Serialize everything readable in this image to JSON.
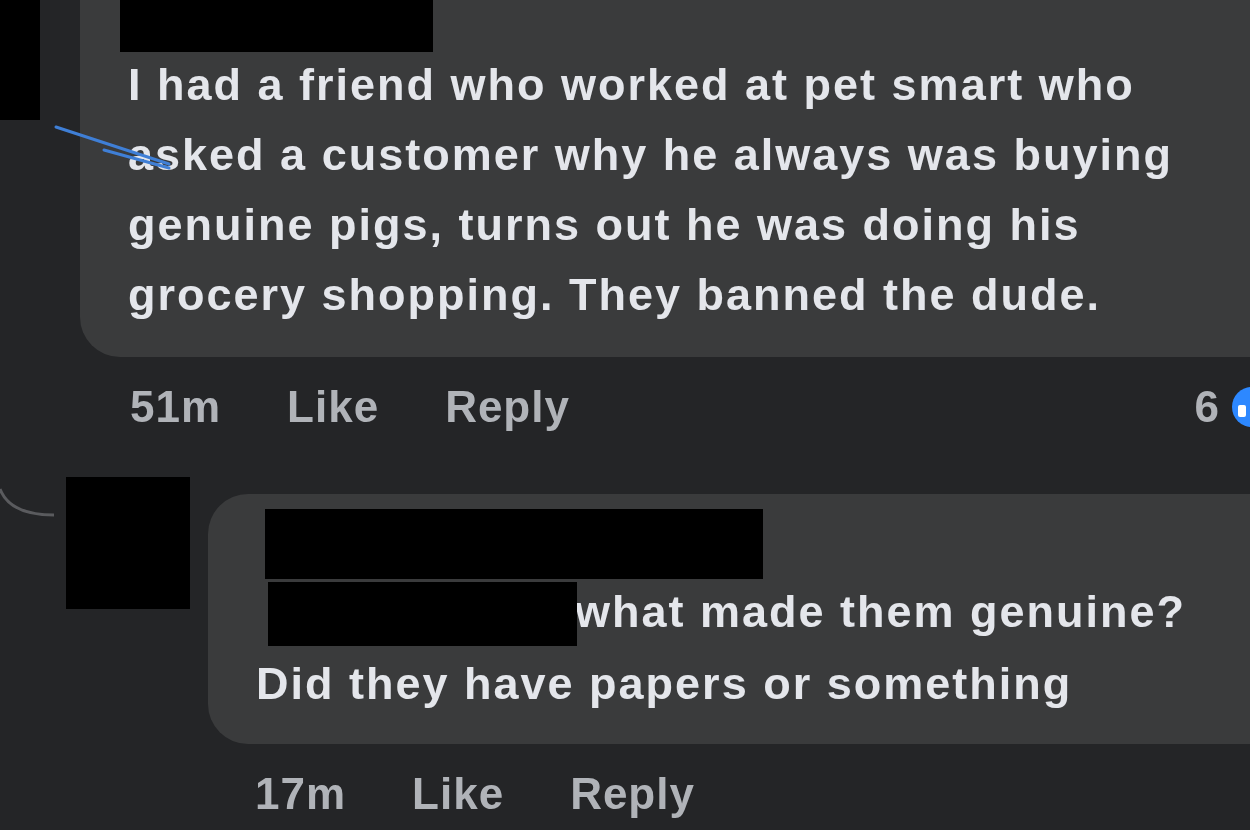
{
  "comment": {
    "lines": [
      "I had a friend who worked at pet smart who",
      "asked a customer why he always was buying",
      "genuine pigs, turns out he was doing his",
      "grocery shopping. They banned the dude."
    ],
    "time": "51m",
    "actions": [
      "Like",
      "Reply"
    ],
    "reaction_count": "6"
  },
  "reply": {
    "lines": [
      "what made them genuine?",
      "Did they have papers or something"
    ],
    "time": "17m",
    "actions": [
      "Like",
      "Reply"
    ]
  }
}
